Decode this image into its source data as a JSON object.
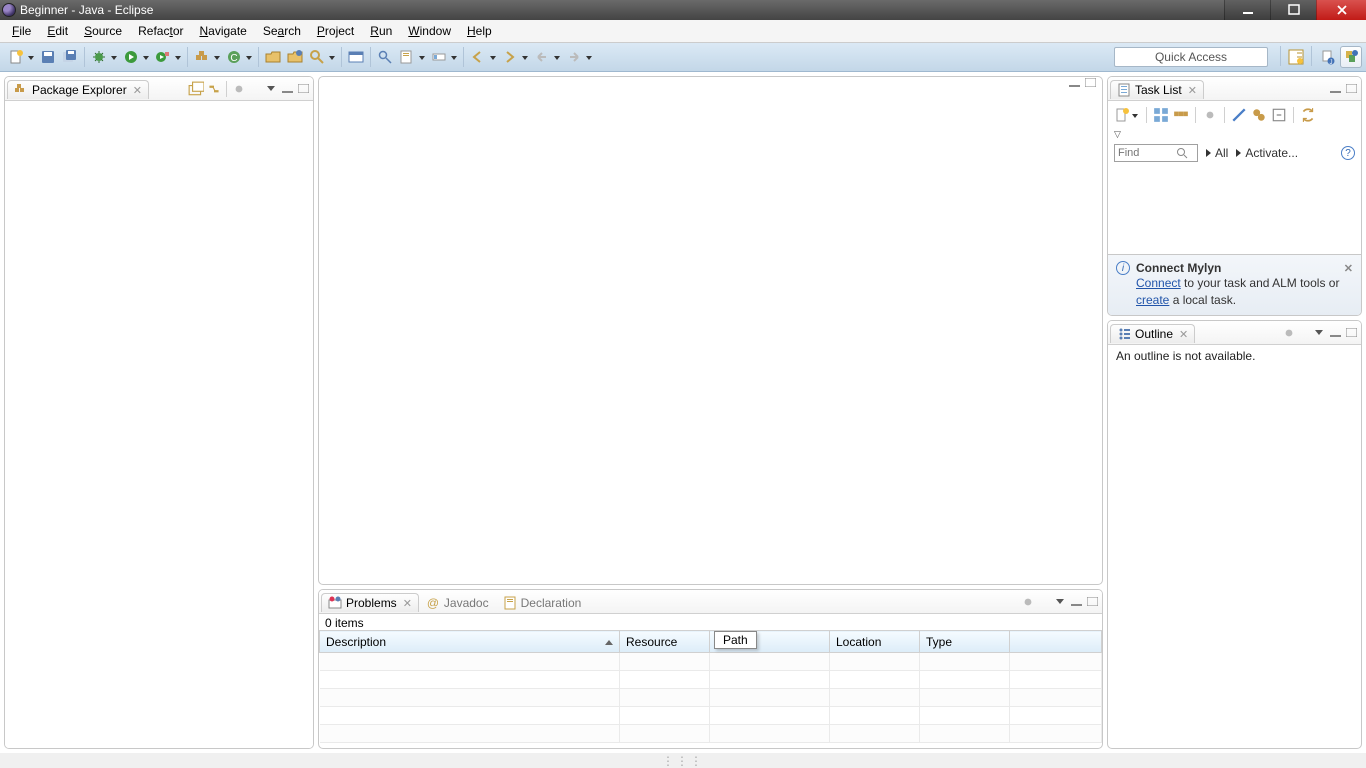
{
  "window": {
    "title": "Beginner - Java - Eclipse"
  },
  "menu": {
    "items": [
      {
        "label": "File",
        "u": "F"
      },
      {
        "label": "Edit",
        "u": "E"
      },
      {
        "label": "Source",
        "u": "S"
      },
      {
        "label": "Refactor",
        "u": "t"
      },
      {
        "label": "Navigate",
        "u": "N"
      },
      {
        "label": "Search",
        "u": "a"
      },
      {
        "label": "Project",
        "u": "P"
      },
      {
        "label": "Run",
        "u": "R"
      },
      {
        "label": "Window",
        "u": "W"
      },
      {
        "label": "Help",
        "u": "H"
      }
    ]
  },
  "toolbar": {
    "quick_access": "Quick Access"
  },
  "views": {
    "package_explorer": {
      "title": "Package Explorer"
    },
    "task_list": {
      "title": "Task List",
      "find_placeholder": "Find",
      "all_label": "All",
      "activate_label": "Activate..."
    },
    "mylyn": {
      "title": "Connect Mylyn",
      "connect": "Connect",
      "mid": " to your task and ALM tools or ",
      "create": "create",
      "tail": " a local task."
    },
    "outline": {
      "title": "Outline",
      "empty": "An outline is not available."
    },
    "problems": {
      "tabs": {
        "problems": "Problems",
        "javadoc": "Javadoc",
        "declaration": "Declaration"
      },
      "items_label": "0 items",
      "columns": [
        "Description",
        "Resource",
        "Path",
        "Location",
        "Type"
      ],
      "tooltip": "Path"
    }
  }
}
